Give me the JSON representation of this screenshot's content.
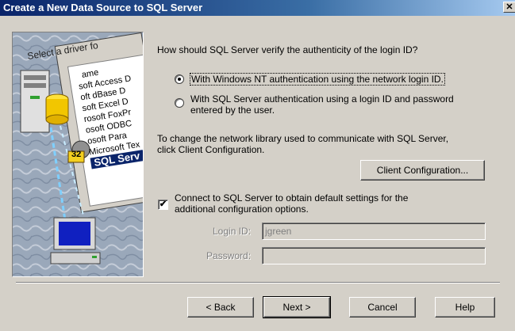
{
  "window": {
    "title": "Create a New Data Source to SQL Server",
    "close_glyph": "✕"
  },
  "illustration": {
    "select_label": "Select a driver fo",
    "drivers": [
      "ame",
      "soft Access D",
      "oft dBase D",
      "soft Excel D",
      "rosoft FoxPr",
      "osoft ODBC",
      "osoft Para",
      "Microsoft Tex",
      "SQL Serv"
    ],
    "badge": "32"
  },
  "question": "How should SQL Server verify the authenticity of the login ID?",
  "auth": {
    "nt_label": "With Windows NT authentication using the network login ID.",
    "sql_label_line1": "With SQL Server authentication using a login ID and password",
    "sql_label_line2": "entered by the user.",
    "selected": "nt"
  },
  "netlib": {
    "line1": "To change the network library used to communicate with SQL Server,",
    "line2": "click Client Configuration.",
    "button": "Client Configuration..."
  },
  "connect": {
    "checked": true,
    "check_glyph": "✔",
    "line1": "Connect to SQL Server to obtain default settings for the",
    "line2": "additional configuration options."
  },
  "login": {
    "label": "Login ID:",
    "value": "jgreen"
  },
  "password": {
    "label": "Password:",
    "value": ""
  },
  "buttons": {
    "back": "< Back",
    "next": "Next >",
    "cancel": "Cancel",
    "help": "Help"
  }
}
